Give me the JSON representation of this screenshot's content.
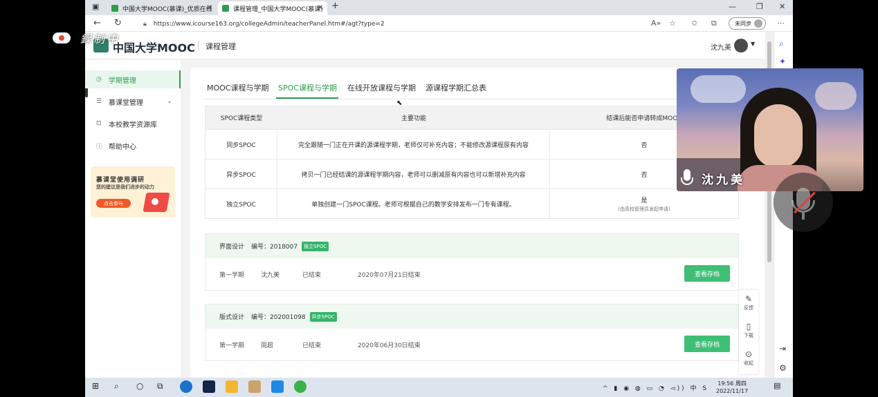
{
  "browser": {
    "tabs": [
      {
        "title": "中国大学MOOC(慕课)_优质在线",
        "active": false
      },
      {
        "title": "课程管理_中国大学MOOC(慕课)",
        "active": true
      }
    ],
    "new_tab": "+",
    "url": "https://www.icourse163.org/collegeAdmin/teacherPanel.htm#/agt?type=2",
    "sync_label": "未同步"
  },
  "recording": {
    "label": "録制中"
  },
  "header": {
    "logo_text": "中国大学MOOC",
    "section": "课程管理",
    "user_name": "沈九美"
  },
  "sidebar": {
    "items": [
      {
        "label": "学期管理",
        "icon": "clock-icon",
        "active": true
      },
      {
        "label": "慕课堂管理",
        "icon": "list-icon",
        "active": false
      },
      {
        "label": "本校教学资源库",
        "icon": "lock-icon",
        "active": false
      },
      {
        "label": "帮助中心",
        "icon": "help-icon",
        "active": false
      }
    ],
    "banner": {
      "title": "慕课堂使用调研",
      "subtitle": "您的建议是我们进步的动力",
      "button": "点击参与"
    }
  },
  "main": {
    "tabs": [
      {
        "label": "MOOC课程与学期",
        "active": false
      },
      {
        "label": "SPOC课程与学期",
        "active": true
      },
      {
        "label": "在线开放课程与学期",
        "active": false
      },
      {
        "label": "源课程学期汇总表",
        "active": false
      }
    ],
    "type_table": {
      "headers": [
        "SPOC课程类型",
        "主要功能",
        "结课后能否申请转成MOOC"
      ],
      "rows": [
        {
          "type": "同步SPOC",
          "function": "完全跟随一门正在开课的源课程学期，老师仅可补充内容；不能修改源课程原有内容",
          "convert": "否",
          "note": ""
        },
        {
          "type": "异步SPOC",
          "function": "拷贝一门已经结课的源课程学期内容，老师可以删减原有内容也可以新增补充内容",
          "convert": "否",
          "note": ""
        },
        {
          "type": "独立SPOC",
          "function": "单独创建一门SPOC课程。老师可根据自己的教学安排发布一门专有课程。",
          "convert": "是",
          "note": "(由高校管理员发起申请)"
        }
      ]
    },
    "courses": [
      {
        "name": "界面设计",
        "number": "编号：2018007",
        "badge": "独立SPOC",
        "term": "第一学期",
        "teacher": "沈九美",
        "status": "已结束",
        "end": "2020年07月21日结束",
        "action": "查看存档"
      },
      {
        "name": "版式设计",
        "number": "编号：202001098",
        "badge": "异步SPOC",
        "term": "第一学期",
        "teacher": "周超",
        "status": "已结束",
        "end": "2020年06月30日结束",
        "action": "查看存档"
      }
    ]
  },
  "float_tools": [
    {
      "label": "反馈",
      "icon": "edit-icon"
    },
    {
      "label": "下载",
      "icon": "phone-icon"
    },
    {
      "label": "收起",
      "icon": "chevron-down-icon"
    }
  ],
  "webcam": {
    "name": "沈九美"
  },
  "taskbar": {
    "time": "19:56 周四",
    "date": "2022/11/17"
  },
  "colors": {
    "accent": "#2e9d4e",
    "button": "#3fbf75",
    "course_header": "#eef8ef"
  }
}
